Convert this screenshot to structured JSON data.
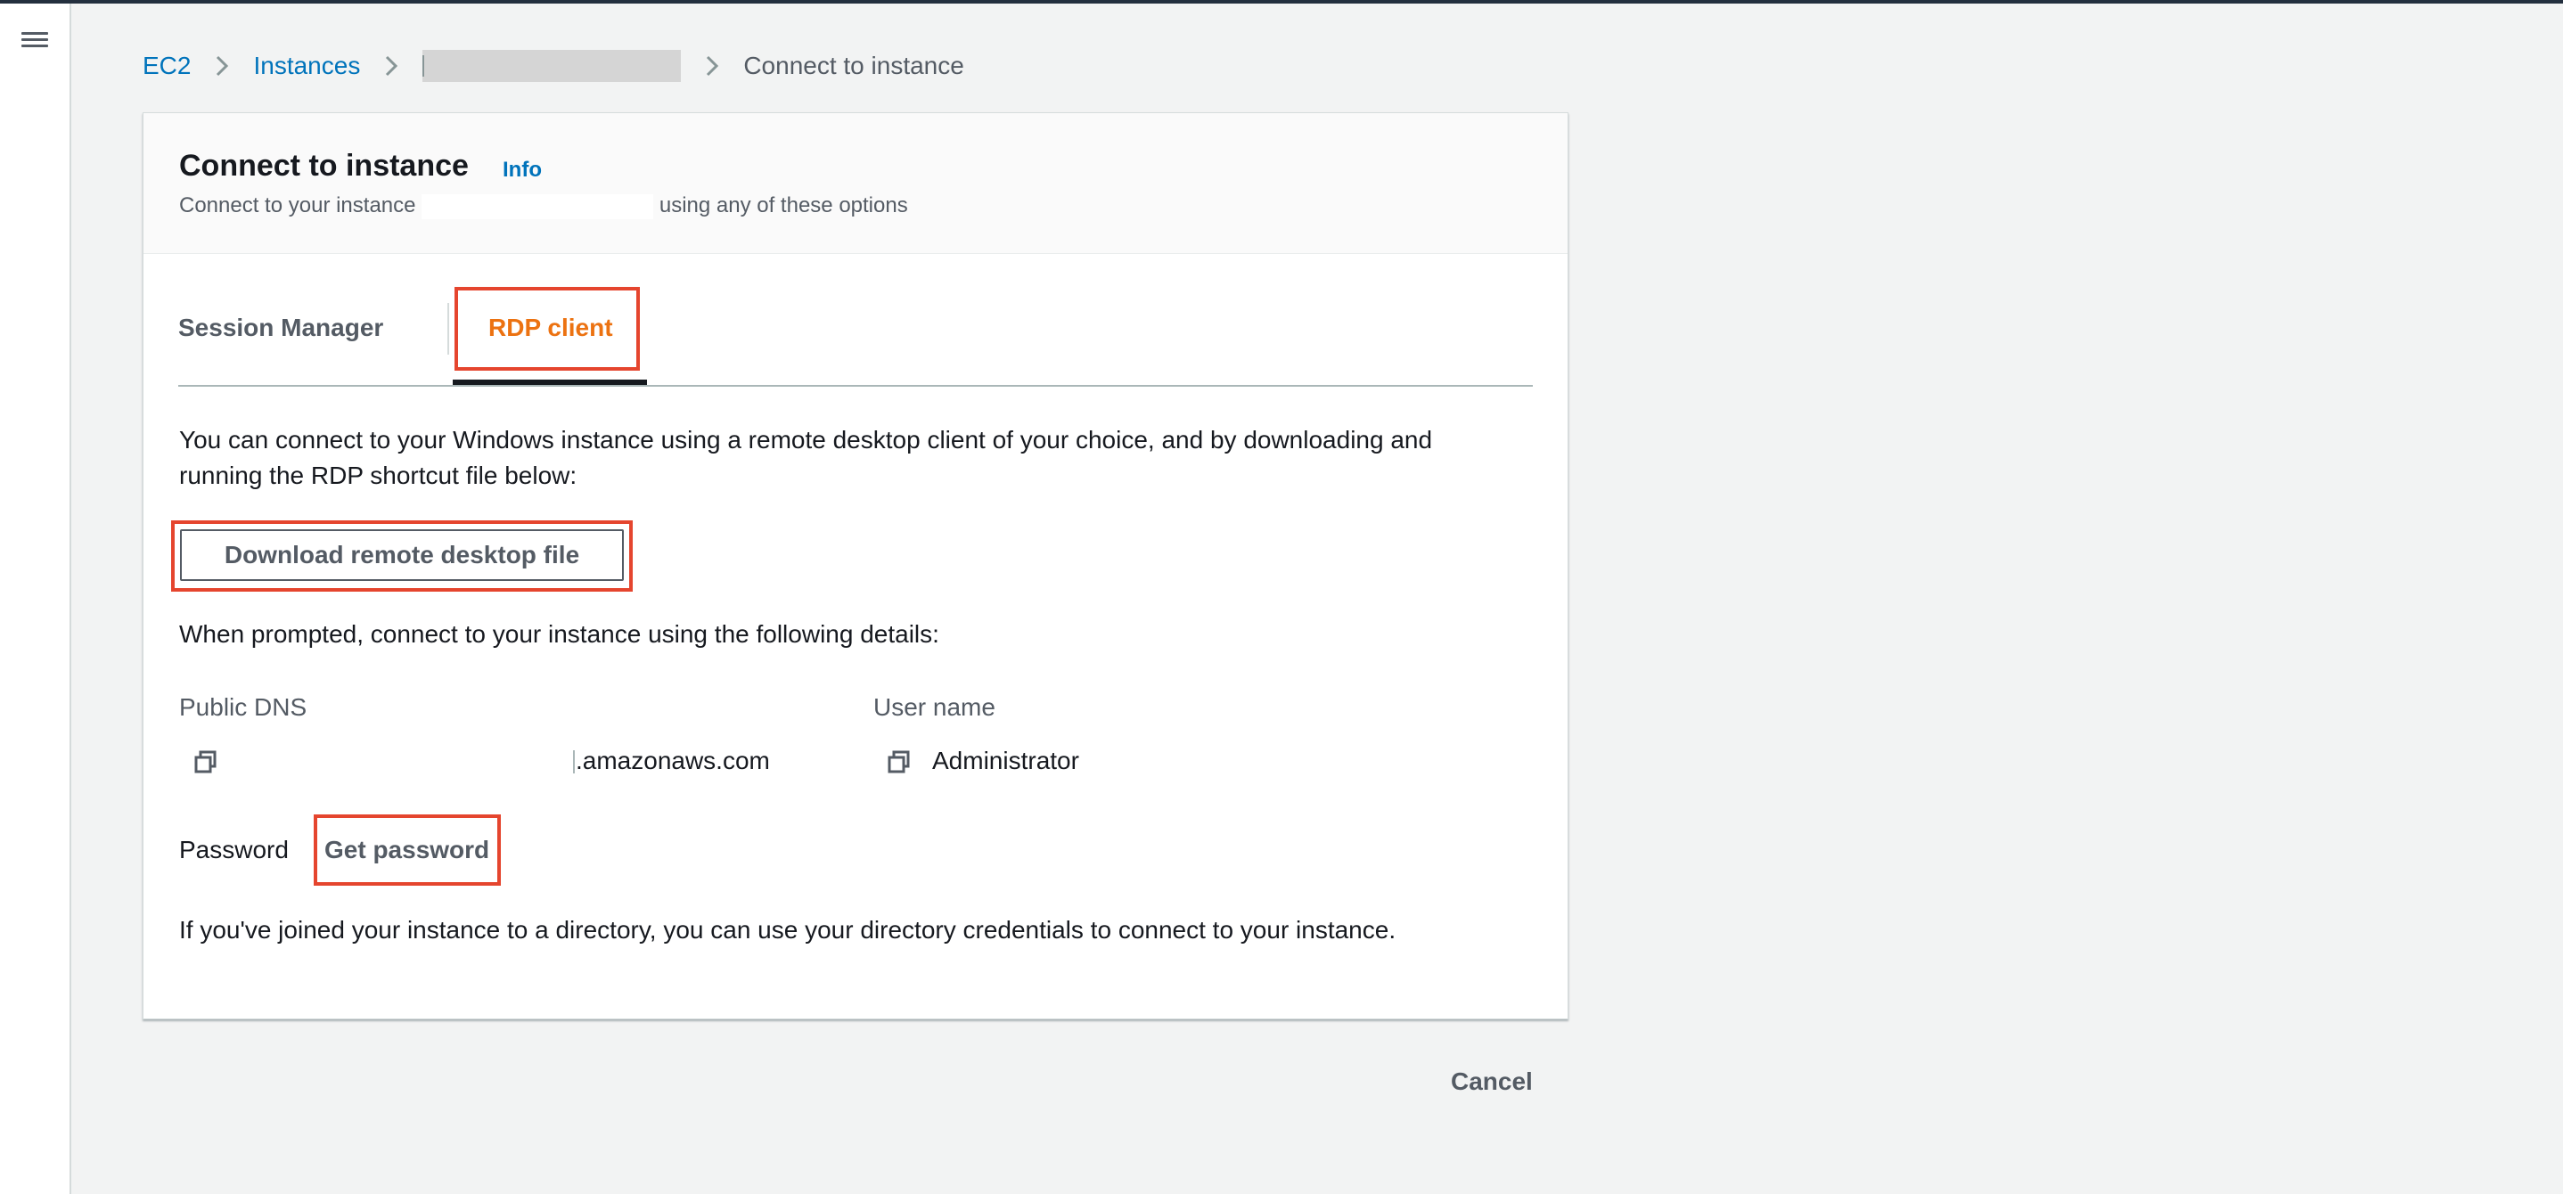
{
  "breadcrumb": {
    "ec2": "EC2",
    "instances": "Instances",
    "current": "Connect to instance"
  },
  "panel": {
    "title": "Connect to instance",
    "info": "Info",
    "subtitle_before": "Connect to your instance",
    "subtitle_after": "using any of these options"
  },
  "tabs": {
    "session_manager": "Session Manager",
    "rdp_client": "RDP client"
  },
  "rdp": {
    "description": "You can connect to your Windows instance using a remote desktop client of your choice, and by downloading and running the RDP shortcut file below:",
    "download_button": "Download remote desktop file",
    "prompt": "When prompted, connect to your instance using the following details:",
    "public_dns_label": "Public DNS",
    "public_dns_value": ".amazonaws.com",
    "username_label": "User name",
    "username_value": "Administrator",
    "password_label": "Password",
    "get_password": "Get password",
    "directory_note": "If you've joined your instance to a directory, you can use your directory credentials to connect to your instance."
  },
  "footer": {
    "cancel": "Cancel"
  },
  "colors": {
    "link": "#0073bb",
    "active_tab": "#ec7211",
    "highlight": "#e5452e"
  }
}
